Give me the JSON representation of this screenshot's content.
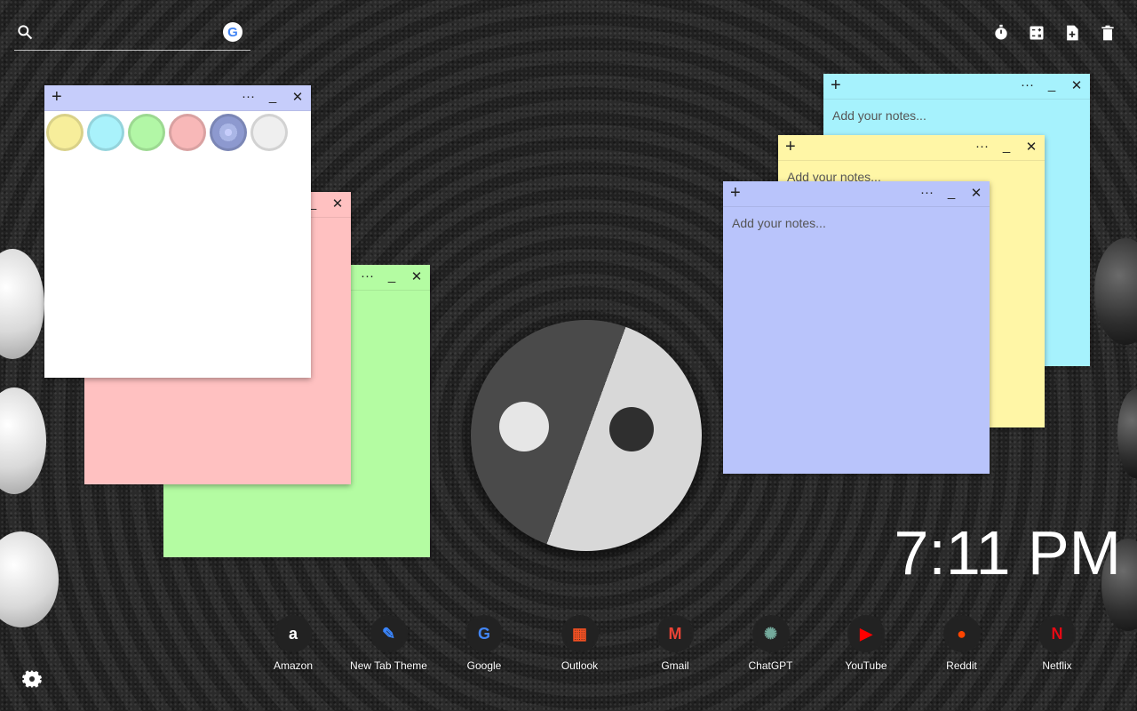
{
  "search": {
    "placeholder": ""
  },
  "toolbar": {
    "icons": [
      "timer-icon",
      "calculator-icon",
      "new-note-icon",
      "trash-icon"
    ]
  },
  "notes": {
    "palette": {
      "plus": "+",
      "more": "···",
      "minimize": "_",
      "close": "✕",
      "colors": [
        "#f7ee9b",
        "#a9f2fb",
        "#b2f7a6",
        "#f8b8b8",
        "#aab6e6",
        "#efefef"
      ]
    },
    "pink": {
      "minimize": "_",
      "close": "✕",
      "color": "#ffc1c1"
    },
    "green": {
      "more": "···",
      "minimize": "_",
      "close": "✕",
      "color": "#b4fca2"
    },
    "cyan": {
      "plus": "+",
      "more": "···",
      "minimize": "_",
      "close": "✕",
      "placeholder": "Add your notes...",
      "color": "#a6f2fd"
    },
    "yellow": {
      "plus": "+",
      "more": "···",
      "minimize": "_",
      "close": "✕",
      "placeholder": "Add your notes...",
      "color": "#fff6a6"
    },
    "blue": {
      "plus": "+",
      "more": "···",
      "minimize": "_",
      "close": "✕",
      "placeholder": "Add your notes...",
      "color": "#b9c4fb"
    }
  },
  "clock": {
    "time": "7:11 PM"
  },
  "dock": [
    {
      "label": "Amazon",
      "glyph": "a",
      "color": "#ffffff",
      "icon": "amazon-icon"
    },
    {
      "label": "New Tab Theme",
      "glyph": "✎",
      "color": "#3a86ff",
      "icon": "new-tab-theme-icon"
    },
    {
      "label": "Google",
      "glyph": "G",
      "color": "#4285F4",
      "icon": "google-icon"
    },
    {
      "label": "Outlook",
      "glyph": "▦",
      "color": "#f25022",
      "icon": "outlook-icon"
    },
    {
      "label": "Gmail",
      "glyph": "M",
      "color": "#ea4335",
      "icon": "gmail-icon"
    },
    {
      "label": "ChatGPT",
      "glyph": "✺",
      "color": "#74aa9c",
      "icon": "chatgpt-icon"
    },
    {
      "label": "YouTube",
      "glyph": "▶",
      "color": "#ff0000",
      "icon": "youtube-icon"
    },
    {
      "label": "Reddit",
      "glyph": "●",
      "color": "#ff4500",
      "icon": "reddit-icon"
    },
    {
      "label": "Netflix",
      "glyph": "N",
      "color": "#e50914",
      "icon": "netflix-icon"
    }
  ]
}
